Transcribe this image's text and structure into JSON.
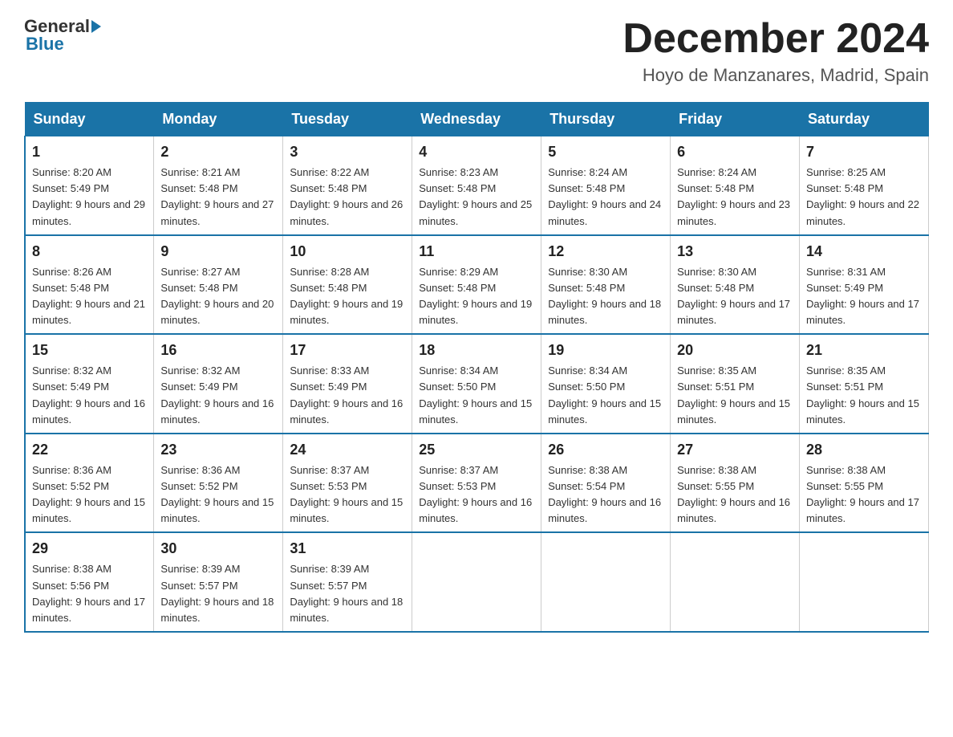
{
  "header": {
    "logo": {
      "general": "General",
      "blue": "Blue"
    },
    "title": "December 2024",
    "location": "Hoyo de Manzanares, Madrid, Spain"
  },
  "days_of_week": [
    "Sunday",
    "Monday",
    "Tuesday",
    "Wednesday",
    "Thursday",
    "Friday",
    "Saturday"
  ],
  "weeks": [
    [
      {
        "day": "1",
        "sunrise": "8:20 AM",
        "sunset": "5:49 PM",
        "daylight": "9 hours and 29 minutes."
      },
      {
        "day": "2",
        "sunrise": "8:21 AM",
        "sunset": "5:48 PM",
        "daylight": "9 hours and 27 minutes."
      },
      {
        "day": "3",
        "sunrise": "8:22 AM",
        "sunset": "5:48 PM",
        "daylight": "9 hours and 26 minutes."
      },
      {
        "day": "4",
        "sunrise": "8:23 AM",
        "sunset": "5:48 PM",
        "daylight": "9 hours and 25 minutes."
      },
      {
        "day": "5",
        "sunrise": "8:24 AM",
        "sunset": "5:48 PM",
        "daylight": "9 hours and 24 minutes."
      },
      {
        "day": "6",
        "sunrise": "8:24 AM",
        "sunset": "5:48 PM",
        "daylight": "9 hours and 23 minutes."
      },
      {
        "day": "7",
        "sunrise": "8:25 AM",
        "sunset": "5:48 PM",
        "daylight": "9 hours and 22 minutes."
      }
    ],
    [
      {
        "day": "8",
        "sunrise": "8:26 AM",
        "sunset": "5:48 PM",
        "daylight": "9 hours and 21 minutes."
      },
      {
        "day": "9",
        "sunrise": "8:27 AM",
        "sunset": "5:48 PM",
        "daylight": "9 hours and 20 minutes."
      },
      {
        "day": "10",
        "sunrise": "8:28 AM",
        "sunset": "5:48 PM",
        "daylight": "9 hours and 19 minutes."
      },
      {
        "day": "11",
        "sunrise": "8:29 AM",
        "sunset": "5:48 PM",
        "daylight": "9 hours and 19 minutes."
      },
      {
        "day": "12",
        "sunrise": "8:30 AM",
        "sunset": "5:48 PM",
        "daylight": "9 hours and 18 minutes."
      },
      {
        "day": "13",
        "sunrise": "8:30 AM",
        "sunset": "5:48 PM",
        "daylight": "9 hours and 17 minutes."
      },
      {
        "day": "14",
        "sunrise": "8:31 AM",
        "sunset": "5:49 PM",
        "daylight": "9 hours and 17 minutes."
      }
    ],
    [
      {
        "day": "15",
        "sunrise": "8:32 AM",
        "sunset": "5:49 PM",
        "daylight": "9 hours and 16 minutes."
      },
      {
        "day": "16",
        "sunrise": "8:32 AM",
        "sunset": "5:49 PM",
        "daylight": "9 hours and 16 minutes."
      },
      {
        "day": "17",
        "sunrise": "8:33 AM",
        "sunset": "5:49 PM",
        "daylight": "9 hours and 16 minutes."
      },
      {
        "day": "18",
        "sunrise": "8:34 AM",
        "sunset": "5:50 PM",
        "daylight": "9 hours and 15 minutes."
      },
      {
        "day": "19",
        "sunrise": "8:34 AM",
        "sunset": "5:50 PM",
        "daylight": "9 hours and 15 minutes."
      },
      {
        "day": "20",
        "sunrise": "8:35 AM",
        "sunset": "5:51 PM",
        "daylight": "9 hours and 15 minutes."
      },
      {
        "day": "21",
        "sunrise": "8:35 AM",
        "sunset": "5:51 PM",
        "daylight": "9 hours and 15 minutes."
      }
    ],
    [
      {
        "day": "22",
        "sunrise": "8:36 AM",
        "sunset": "5:52 PM",
        "daylight": "9 hours and 15 minutes."
      },
      {
        "day": "23",
        "sunrise": "8:36 AM",
        "sunset": "5:52 PM",
        "daylight": "9 hours and 15 minutes."
      },
      {
        "day": "24",
        "sunrise": "8:37 AM",
        "sunset": "5:53 PM",
        "daylight": "9 hours and 15 minutes."
      },
      {
        "day": "25",
        "sunrise": "8:37 AM",
        "sunset": "5:53 PM",
        "daylight": "9 hours and 16 minutes."
      },
      {
        "day": "26",
        "sunrise": "8:38 AM",
        "sunset": "5:54 PM",
        "daylight": "9 hours and 16 minutes."
      },
      {
        "day": "27",
        "sunrise": "8:38 AM",
        "sunset": "5:55 PM",
        "daylight": "9 hours and 16 minutes."
      },
      {
        "day": "28",
        "sunrise": "8:38 AM",
        "sunset": "5:55 PM",
        "daylight": "9 hours and 17 minutes."
      }
    ],
    [
      {
        "day": "29",
        "sunrise": "8:38 AM",
        "sunset": "5:56 PM",
        "daylight": "9 hours and 17 minutes."
      },
      {
        "day": "30",
        "sunrise": "8:39 AM",
        "sunset": "5:57 PM",
        "daylight": "9 hours and 18 minutes."
      },
      {
        "day": "31",
        "sunrise": "8:39 AM",
        "sunset": "5:57 PM",
        "daylight": "9 hours and 18 minutes."
      },
      null,
      null,
      null,
      null
    ]
  ]
}
